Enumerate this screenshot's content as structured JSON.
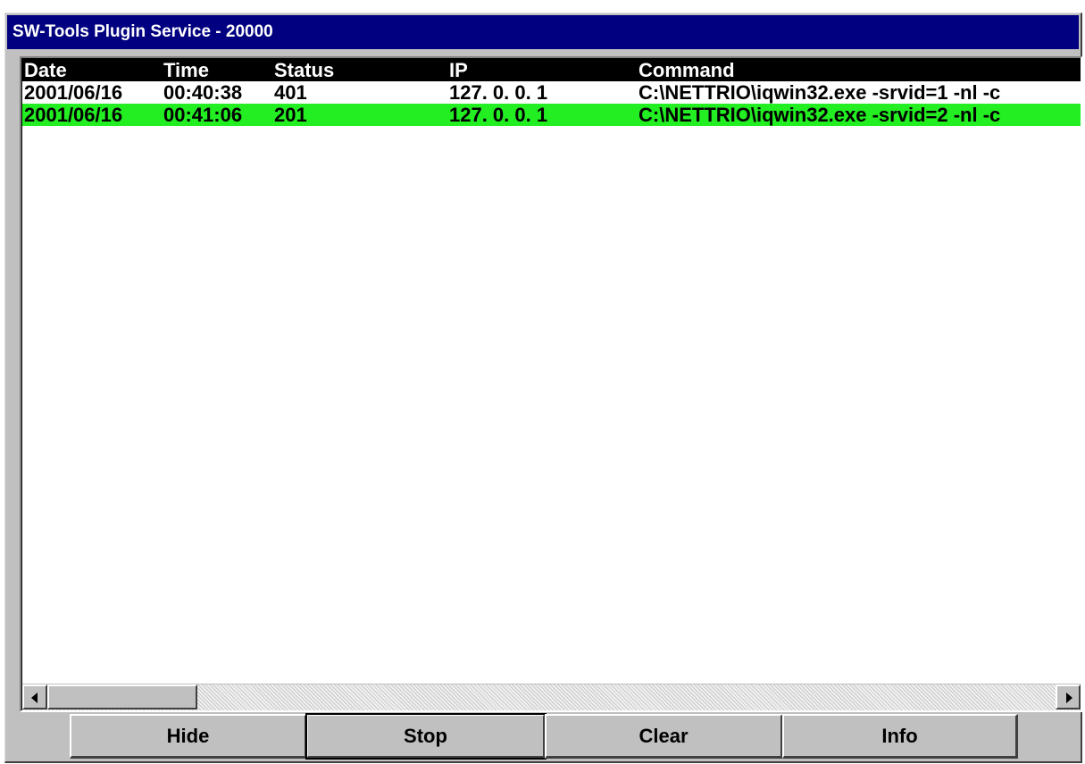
{
  "window": {
    "title": "SW-Tools Plugin Service - 20000"
  },
  "table": {
    "columns": [
      "Date",
      "Time",
      "Status",
      "IP",
      "Command"
    ],
    "rows": [
      {
        "date": "2001/06/16",
        "time": "00:40:38",
        "status": "401",
        "ip": "127. 0. 0. 1",
        "command": "C:\\NETTRIO\\iqwin32.exe -srvid=1 -nl -c",
        "highlight": false
      },
      {
        "date": "2001/06/16",
        "time": "00:41:06",
        "status": "201",
        "ip": "127. 0. 0. 1",
        "command": "C:\\NETTRIO\\iqwin32.exe -srvid=2 -nl -c",
        "highlight": true
      }
    ]
  },
  "buttons": {
    "hide": "Hide",
    "stop": "Stop",
    "clear": "Clear",
    "info": "Info"
  },
  "colors": {
    "titlebar": "#000080",
    "header": "#000000",
    "highlight_row": "#22ee22"
  },
  "icons": {
    "scroll_left": "arrow-left-icon",
    "scroll_right": "arrow-right-icon"
  }
}
